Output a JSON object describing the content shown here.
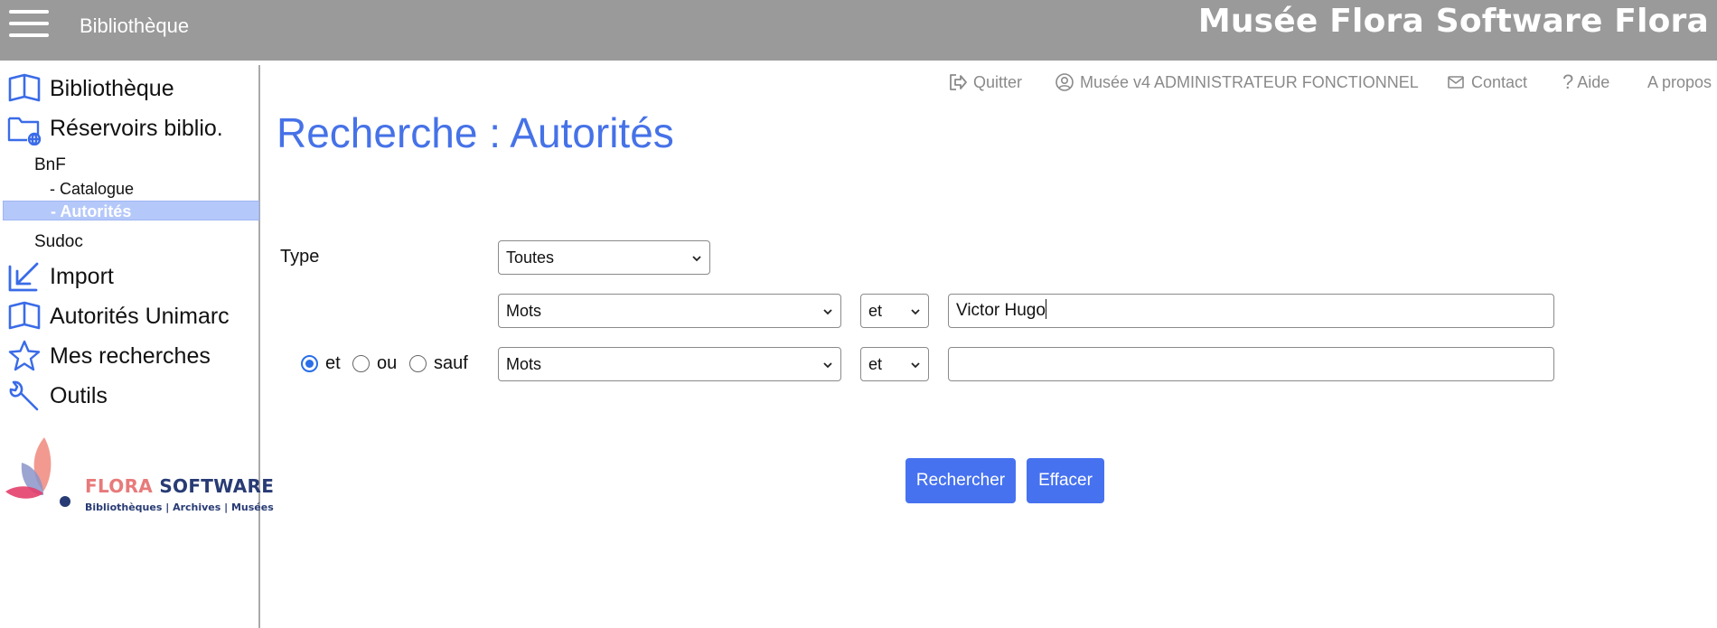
{
  "header": {
    "section": "Bibliothèque",
    "app_title": "Musée Flora Software Flora"
  },
  "sidebar": {
    "items": [
      {
        "label": "Bibliothèque",
        "icon": "open-book-icon"
      },
      {
        "label": "Réservoirs biblio.",
        "icon": "folder-globe-icon"
      },
      {
        "label": "Import",
        "icon": "import-arrow-icon"
      },
      {
        "label": "Autorités Unimarc",
        "icon": "open-book-icon"
      },
      {
        "label": "Mes recherches",
        "icon": "star-icon"
      },
      {
        "label": "Outils",
        "icon": "wrench-icon"
      }
    ],
    "reservoirs": {
      "bnf": {
        "label": "BnF",
        "children": [
          "- Catalogue",
          "- Autorités"
        ],
        "active": "- Autorités"
      },
      "sudoc": "Sudoc"
    },
    "logo": {
      "word1": "FLORA",
      "word2": "SOFTWARE",
      "tagline": "Bibliothèques | Archives | Musées"
    }
  },
  "utility_bar": {
    "quit": "Quitter",
    "user": "Musée v4 ADMINISTRATEUR FONCTIONNEL",
    "contact": "Contact",
    "help": "Aide",
    "about": "A propos"
  },
  "page_title": "Recherche : Autorités",
  "form": {
    "type_label": "Type",
    "type_value": "Toutes",
    "row1": {
      "field": "Mots",
      "operator": "et",
      "value": "Victor Hugo"
    },
    "row2": {
      "field": "Mots",
      "operator": "et",
      "value": ""
    },
    "boolean": {
      "options": [
        "et",
        "ou",
        "sauf"
      ],
      "selected": "et"
    }
  },
  "buttons": {
    "search": "Rechercher",
    "clear": "Effacer"
  },
  "colors": {
    "topbar": "#9a9a9a",
    "accent": "#4672e8",
    "active_item": "#b5c8fa"
  }
}
